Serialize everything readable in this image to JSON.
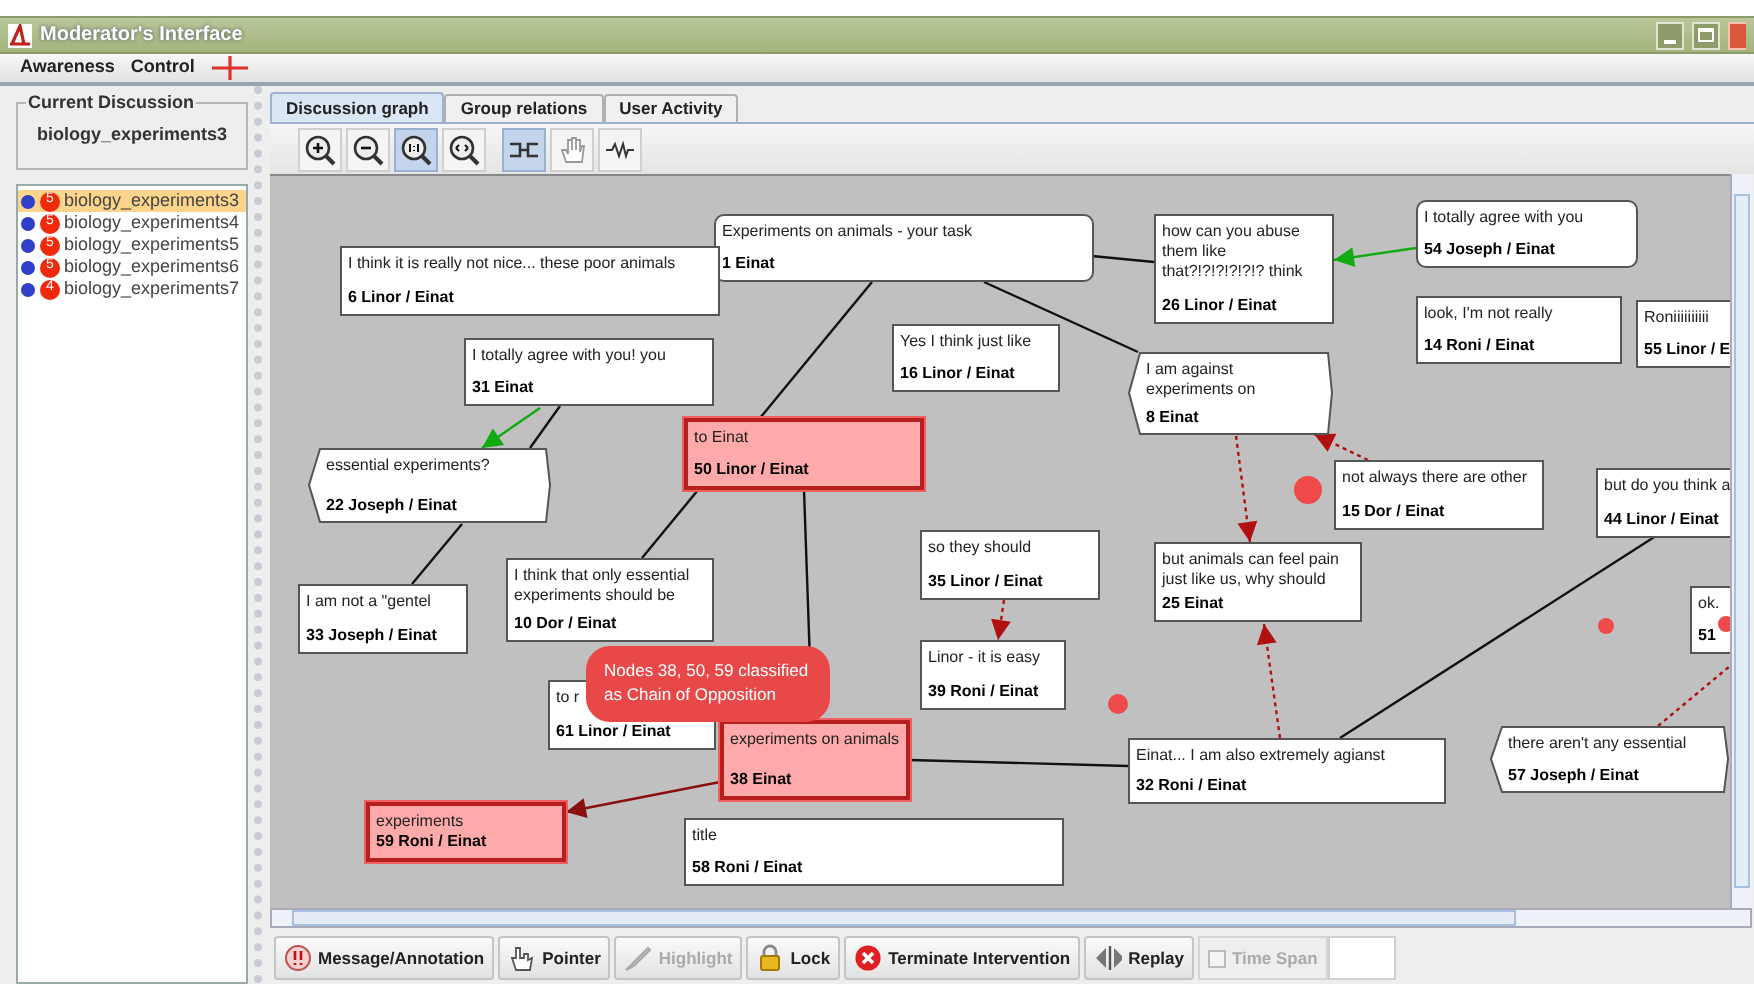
{
  "window": {
    "title": "Moderator's Interface"
  },
  "menu": [
    "Awareness",
    "Control"
  ],
  "sidebar": {
    "legend": "Current Discussion",
    "current": "biology_experiments3",
    "discussions": [
      {
        "label": "biology_experiments3",
        "count": "5",
        "selected": true
      },
      {
        "label": "biology_experiments4",
        "count": "5",
        "selected": false
      },
      {
        "label": "biology_experiments5",
        "count": "5",
        "selected": false
      },
      {
        "label": "biology_experiments6",
        "count": "5",
        "selected": false
      },
      {
        "label": "biology_experiments7",
        "count": "4",
        "selected": false
      }
    ]
  },
  "tabs": [
    {
      "label": "Discussion graph",
      "selected": true
    },
    {
      "label": "Group relations",
      "selected": false
    },
    {
      "label": "User Activity",
      "selected": false
    }
  ],
  "graph_toolbar": [
    {
      "kind": "zoom-in",
      "selected": false
    },
    {
      "kind": "zoom-out",
      "selected": false
    },
    {
      "kind": "zoom-reset",
      "selected": true
    },
    {
      "kind": "zoom-fit",
      "selected": false
    },
    {
      "kind": "connect",
      "selected": true
    },
    {
      "kind": "hand",
      "selected": false
    },
    {
      "kind": "wave",
      "selected": false
    }
  ],
  "graph": {
    "nodes": [
      {
        "text": "Experiments on animals - your task",
        "author": "1 Einat",
        "kind": "rounded",
        "highlighted": false
      },
      {
        "text": "I think it is really not nice... these poor animals",
        "author": "6 Linor / Einat",
        "kind": "rect",
        "highlighted": false
      },
      {
        "text": "I totally agree with you! you",
        "author": "31 Einat",
        "kind": "rect",
        "highlighted": false
      },
      {
        "text": "Yes I think just like",
        "author": "16 Linor / Einat",
        "kind": "rect",
        "highlighted": false
      },
      {
        "text": "essential experiments?",
        "author": "22 Joseph / Einat",
        "kind": "hexagon",
        "highlighted": false
      },
      {
        "text": "to Einat",
        "author": "50 Linor / Einat",
        "kind": "rect",
        "highlighted": true
      },
      {
        "text": "I am not a \"gentel",
        "author": "33 Joseph / Einat",
        "kind": "rect",
        "highlighted": false
      },
      {
        "text": "I think that only essential experiments should be",
        "author": "10 Dor / Einat",
        "kind": "rect",
        "highlighted": false
      },
      {
        "text": "so they should",
        "author": "35 Linor / Einat",
        "kind": "rect",
        "highlighted": false
      },
      {
        "text": "Linor - it is easy",
        "author": "39 Roni / Einat",
        "kind": "rect",
        "highlighted": false
      },
      {
        "text": "to r",
        "author": "61 Linor / Einat",
        "kind": "rect",
        "highlighted": false
      },
      {
        "text": "experiments on animals",
        "author": "38 Einat",
        "kind": "rect",
        "highlighted": true
      },
      {
        "text": "experiments",
        "author": "59 Roni / Einat",
        "kind": "rect",
        "highlighted": true
      },
      {
        "text": "title",
        "author": "58 Roni / Einat",
        "kind": "rect",
        "highlighted": false
      },
      {
        "text": "how can you abuse them like that?!?!?!?!?!? think",
        "author": "26 Linor / Einat",
        "kind": "rect",
        "highlighted": false
      },
      {
        "text": "I totally agree with you",
        "author": "54 Joseph / Einat",
        "kind": "rounded",
        "highlighted": false
      },
      {
        "text": "look, I'm not really",
        "author": "14 Roni / Einat",
        "kind": "rect",
        "highlighted": false
      },
      {
        "text": "Roniiiiiiiiii",
        "author": "55 Linor / E",
        "kind": "rect",
        "highlighted": false
      },
      {
        "text": "I am against experiments on",
        "author": "8 Einat",
        "kind": "hexagon",
        "highlighted": false
      },
      {
        "text": "not always there are other",
        "author": "15 Dor / Einat",
        "kind": "rect",
        "highlighted": false
      },
      {
        "text": "but do you think a",
        "author": "44 Linor / Einat",
        "kind": "rect",
        "highlighted": false
      },
      {
        "text": "but animals can feel pain just like us, why should",
        "author": "25 Einat",
        "kind": "rect",
        "highlighted": false
      },
      {
        "text": "ok.",
        "author": "51",
        "kind": "rect",
        "highlighted": false
      },
      {
        "text": "Einat... I am also extremely agianst",
        "author": "32 Roni / Einat",
        "kind": "rect",
        "highlighted": false
      },
      {
        "text": "there aren't any essential",
        "author": "57 Joseph / Einat",
        "kind": "hexagon",
        "highlighted": false
      }
    ],
    "annotation": "Nodes 38, 50, 59 classified as Chain of Opposition"
  },
  "bottom_toolbar": [
    {
      "kind": "message",
      "label": "Message/Annotation",
      "disabled": false
    },
    {
      "kind": "pointer",
      "label": "Pointer",
      "disabled": false
    },
    {
      "kind": "highlight",
      "label": "Highlight",
      "disabled": true
    },
    {
      "kind": "lock",
      "label": "Lock",
      "disabled": false
    },
    {
      "kind": "terminate",
      "label": "Terminate Intervention",
      "disabled": false
    },
    {
      "kind": "replay",
      "label": "Replay",
      "disabled": false
    },
    {
      "kind": "checkbox",
      "label": "Time Span",
      "checked": false,
      "disabled": true
    }
  ]
}
